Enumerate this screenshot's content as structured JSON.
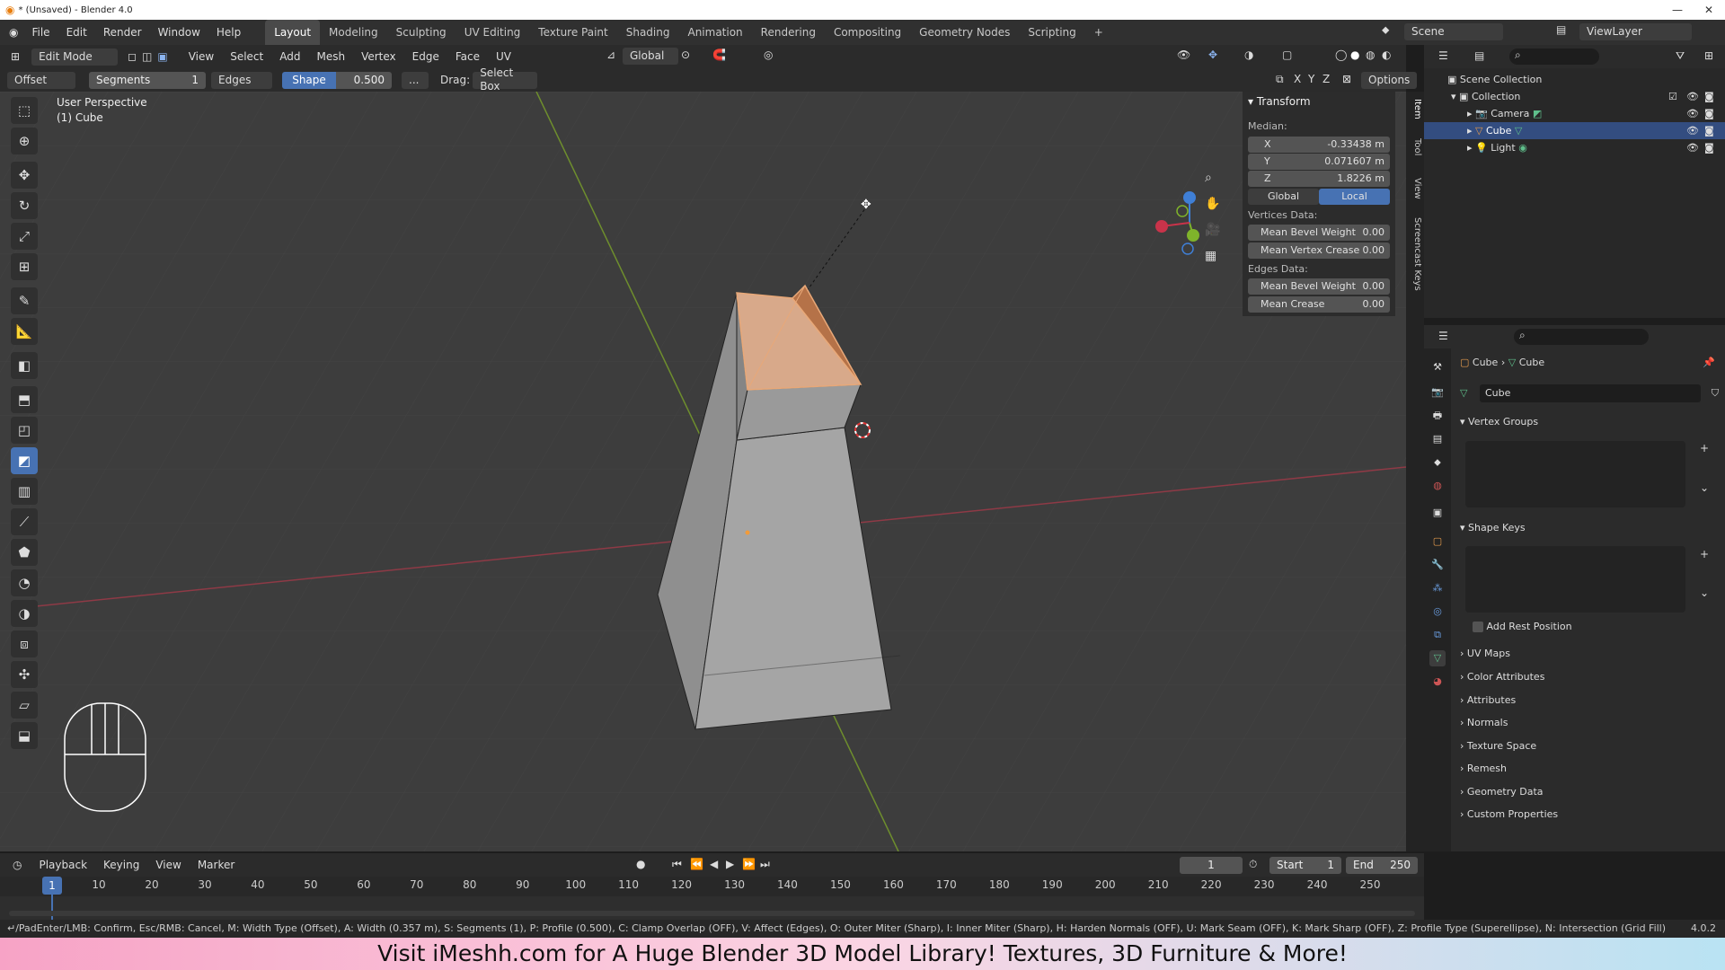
{
  "window": {
    "title": "* (Unsaved) - Blender 4.0"
  },
  "menus": [
    "File",
    "Edit",
    "Render",
    "Window",
    "Help"
  ],
  "workspaces": [
    "Layout",
    "Modeling",
    "Sculpting",
    "UV Editing",
    "Texture Paint",
    "Shading",
    "Animation",
    "Rendering",
    "Compositing",
    "Geometry Nodes",
    "Scripting",
    "+"
  ],
  "top_right": {
    "scene": "Scene",
    "view_layer": "ViewLayer"
  },
  "viewport_header": {
    "mode": "Edit Mode",
    "menus": [
      "View",
      "Select",
      "Add",
      "Mesh",
      "Vertex",
      "Edge",
      "Face",
      "UV"
    ],
    "orientation": "Global"
  },
  "tool_settings": {
    "width_type": "Offset",
    "segments_label": "Segments",
    "segments_value": "1",
    "affect": "Edges",
    "shape_label": "Shape",
    "shape_value": "0.500",
    "more": "...",
    "drag_label": "Drag:",
    "drag_value": "Select Box",
    "axes": [
      "X",
      "Y",
      "Z"
    ],
    "options": "Options"
  },
  "viewport": {
    "perspective": "User Perspective",
    "object": "(1) Cube"
  },
  "n_panel": {
    "section": "Transform",
    "median_label": "Median:",
    "x_label": "X",
    "x_value": "-0.33438 m",
    "y_label": "Y",
    "y_value": "0.071607 m",
    "z_label": "Z",
    "z_value": "1.8226 m",
    "global": "Global",
    "local": "Local",
    "vertices_data": "Vertices Data:",
    "mean_bevel_weight": "Mean Bevel Weight",
    "mbw_value": "0.00",
    "mean_vertex_crease": "Mean Vertex Crease",
    "mvc_value": "0.00",
    "edges_data": "Edges Data:",
    "mean_bevel_weight_e": "Mean Bevel Weight",
    "mbwe_value": "0.00",
    "mean_crease": "Mean Crease",
    "mc_value": "0.00"
  },
  "side_tabs": [
    "Item",
    "Tool",
    "View",
    "Screencast Keys"
  ],
  "outliner": {
    "root": "Scene Collection",
    "collection": "Collection",
    "items": [
      "Camera",
      "Cube",
      "Light"
    ]
  },
  "properties": {
    "breadcrumb_object": "Cube",
    "breadcrumb_data": "Cube",
    "data_name": "Cube",
    "vertex_groups": "Vertex Groups",
    "shape_keys": "Shape Keys",
    "add_rest_position": "Add Rest Position",
    "panels": [
      "UV Maps",
      "Color Attributes",
      "Attributes",
      "Normals",
      "Texture Space",
      "Remesh",
      "Geometry Data",
      "Custom Properties"
    ]
  },
  "timeline": {
    "menus": [
      "Playback",
      "Keying",
      "View",
      "Marker"
    ],
    "current_frame": "1",
    "start_label": "Start",
    "start_value": "1",
    "end_label": "End",
    "end_value": "250",
    "ticks": [
      "1",
      "10",
      "20",
      "30",
      "40",
      "50",
      "60",
      "70",
      "80",
      "90",
      "100",
      "110",
      "120",
      "130",
      "140",
      "150",
      "160",
      "170",
      "180",
      "190",
      "200",
      "210",
      "220",
      "230",
      "240",
      "250"
    ]
  },
  "statusbar": {
    "text": "↵/PadEnter/LMB: Confirm, Esc/RMB: Cancel, M: Width Type (Offset), A: Width (0.357 m), S: Segments (1), P: Profile (0.500), C: Clamp Overlap (OFF), V: Affect (Edges), O: Outer Miter (Sharp), I: Inner Miter (Sharp), H: Harden Normals (OFF), U: Mark Seam (OFF), K: Mark Sharp (OFF), Z: Profile Type (Superellipse), N: Intersection (Grid Fill)",
    "version": "4.0.2"
  },
  "banner": "Visit iMeshh.com for A Huge Blender 3D Model Library! Textures, 3D Furniture & More!",
  "colors": {
    "accent": "#4772b3",
    "selection": "#e8a878",
    "x_axis": "#c9334a",
    "y_axis": "#7fb32b",
    "z_axis": "#3f7fd6"
  }
}
